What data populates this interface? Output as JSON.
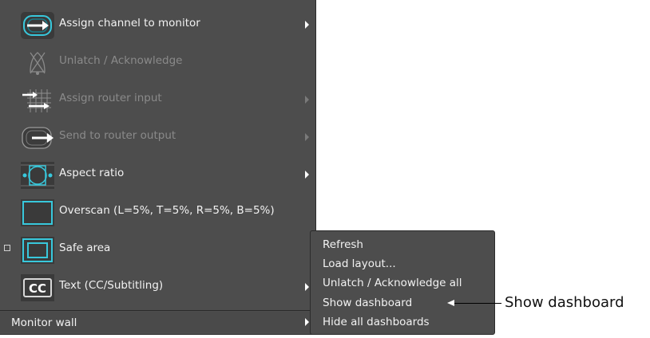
{
  "menu": {
    "items": [
      {
        "label": "Assign channel to monitor",
        "icon": "assign-channel-icon",
        "enabled": true,
        "submenu": true
      },
      {
        "label": "Unlatch / Acknowledge",
        "icon": "unlatch-icon",
        "enabled": false,
        "submenu": false
      },
      {
        "label": "Assign router input",
        "icon": "router-input-icon",
        "enabled": false,
        "submenu": true
      },
      {
        "label": "Send to router output",
        "icon": "router-output-icon",
        "enabled": false,
        "submenu": true
      },
      {
        "label": "Aspect ratio",
        "icon": "aspect-ratio-icon",
        "enabled": true,
        "submenu": true
      },
      {
        "label": "Overscan (L=5%, T=5%, R=5%, B=5%)",
        "icon": "overscan-icon",
        "enabled": true,
        "submenu": false
      },
      {
        "label": "Safe area",
        "icon": "safe-area-icon",
        "enabled": true,
        "submenu": false,
        "checkbox": true
      },
      {
        "label": "Text (CC/Subtitling)",
        "icon": "cc-icon",
        "icon_text": "CC",
        "enabled": true,
        "submenu": true
      }
    ],
    "bottom_item": {
      "label": "Monitor wall",
      "submenu": true
    }
  },
  "submenu": {
    "items": [
      "Refresh",
      "Load layout...",
      "Unlatch / Acknowledge all",
      "Show dashboard",
      "Hide all dashboards"
    ]
  },
  "callout": {
    "label": "Show dashboard"
  },
  "colors": {
    "menu_bg": "#4d4d4d",
    "accent": "#38c8dc",
    "text": "#f2f2f2",
    "disabled_text": "#8a8a8a"
  }
}
